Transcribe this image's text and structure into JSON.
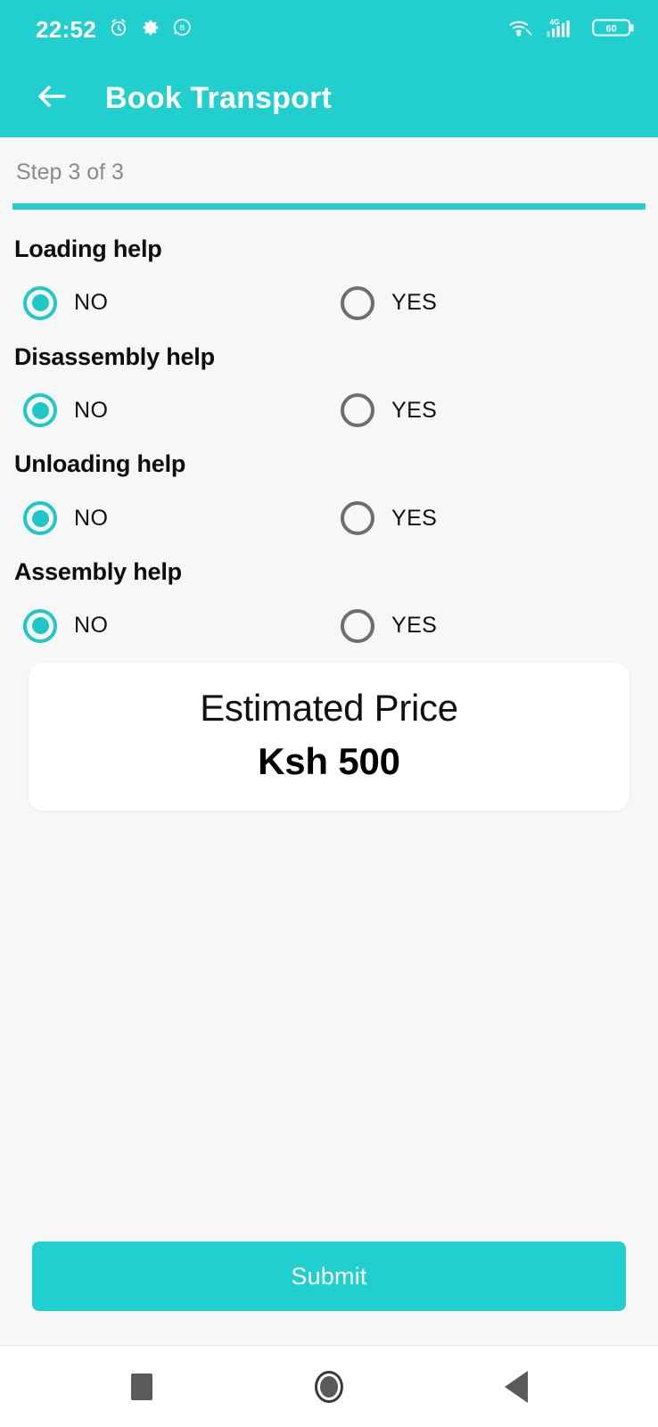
{
  "status_bar": {
    "time": "22:52",
    "icons_left": [
      "alarm-icon",
      "gear-icon",
      "chat-bubble-b-icon"
    ],
    "network_label": "4G",
    "battery_level": "60",
    "icons_right": [
      "wifi-icon",
      "signal-4g-icon",
      "battery-icon"
    ]
  },
  "app_bar": {
    "back_icon": "back-arrow-icon",
    "title": "Book Transport"
  },
  "progress": {
    "step_label": "Step 3 of 3",
    "percent": 100
  },
  "questions": [
    {
      "title": "Loading help",
      "options": [
        {
          "label": "NO",
          "selected": true
        },
        {
          "label": "YES",
          "selected": false
        }
      ]
    },
    {
      "title": "Disassembly help",
      "options": [
        {
          "label": "NO",
          "selected": true
        },
        {
          "label": "YES",
          "selected": false
        }
      ]
    },
    {
      "title": "Unloading help",
      "options": [
        {
          "label": "NO",
          "selected": true
        },
        {
          "label": "YES",
          "selected": false
        }
      ]
    },
    {
      "title": "Assembly help",
      "options": [
        {
          "label": "NO",
          "selected": true
        },
        {
          "label": "YES",
          "selected": false
        }
      ]
    }
  ],
  "price_card": {
    "caption": "Estimated Price",
    "value": "Ksh 500"
  },
  "submit": {
    "label": "Submit"
  },
  "nav_bar": {
    "items": [
      "recents-square-icon",
      "home-circle-icon",
      "back-triangle-icon"
    ]
  },
  "colors": {
    "accent": "#21CFCF",
    "radio_on": "#1FC8C8",
    "radio_off": "#6E6E6E",
    "page_bg": "#F7F7F7",
    "card_bg": "#FFFFFF",
    "title_text": "#0D0D0D",
    "muted_text": "#8A8A8A"
  }
}
